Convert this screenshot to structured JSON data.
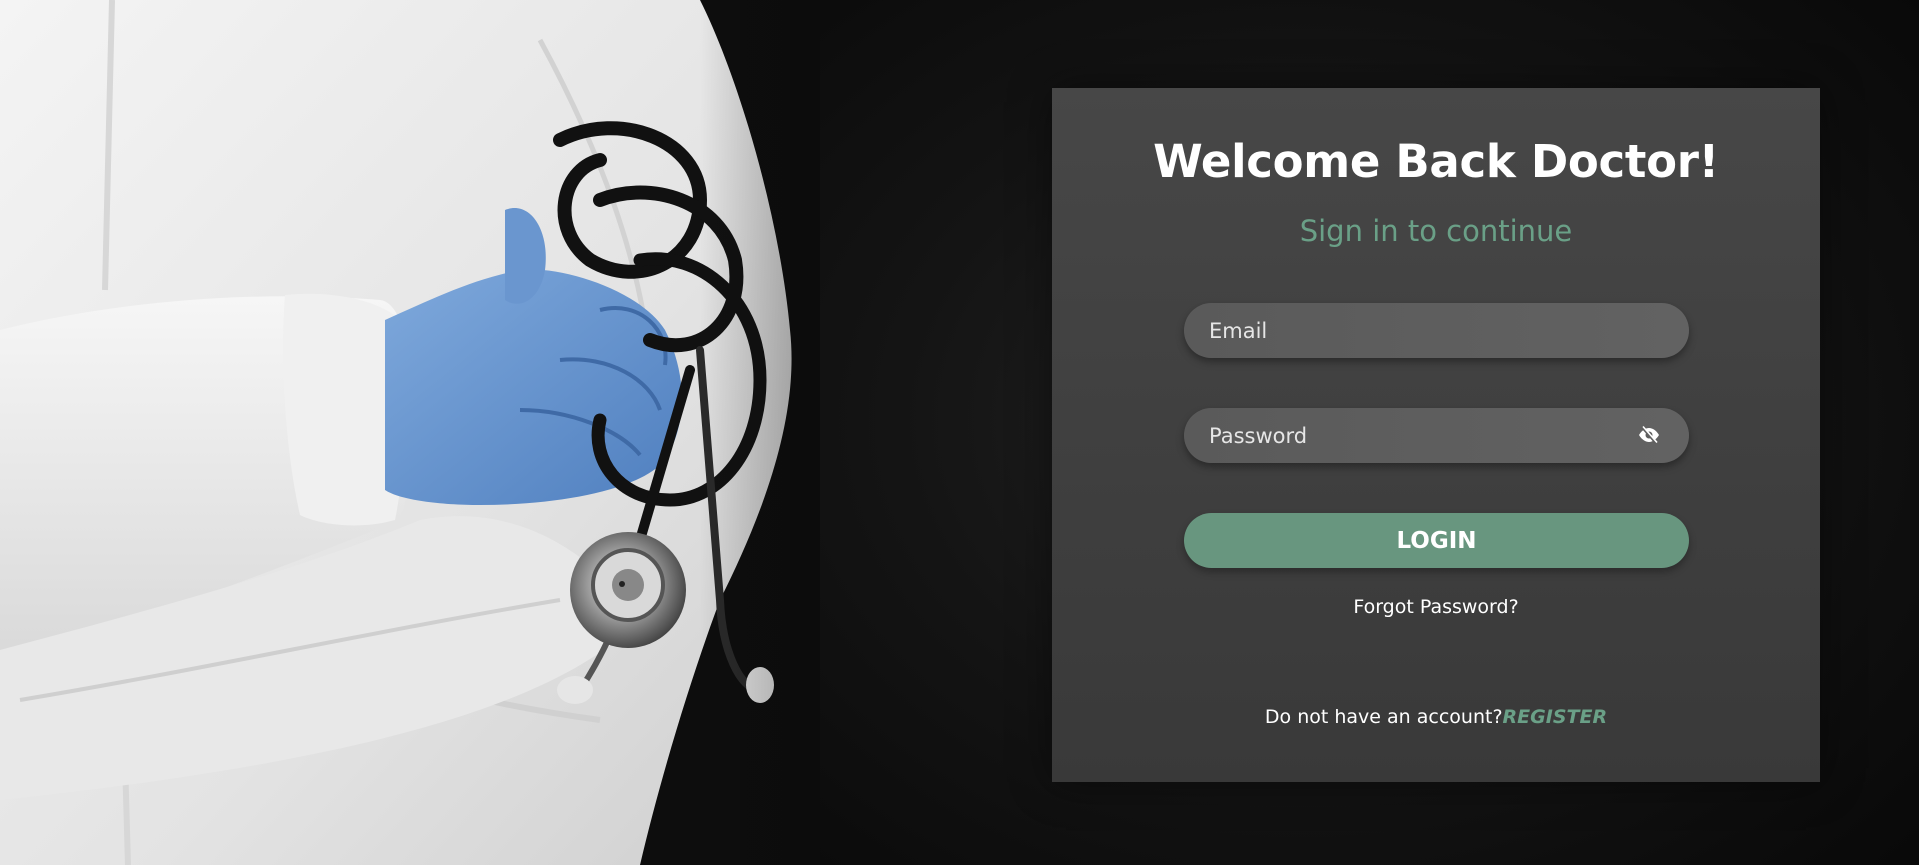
{
  "colors": {
    "accent": "#68967f",
    "accent_text": "#6aa087",
    "card_bg": "#434343",
    "input_bg": "#5e5e5e",
    "page_bg": "#0b0b0b"
  },
  "hero": {
    "image_description_icon": "doctor-with-stethoscope-image"
  },
  "login_card": {
    "title": "Welcome Back Doctor!",
    "subtitle": "Sign in to continue",
    "email": {
      "placeholder": "Email",
      "value": ""
    },
    "password": {
      "placeholder": "Password",
      "value": "",
      "toggle_icon": "eye-slash-icon"
    },
    "login_label": "LOGIN",
    "forgot_label": "Forgot Password?",
    "register_prompt": "Do not have an account?",
    "register_label": "REGISTER"
  }
}
